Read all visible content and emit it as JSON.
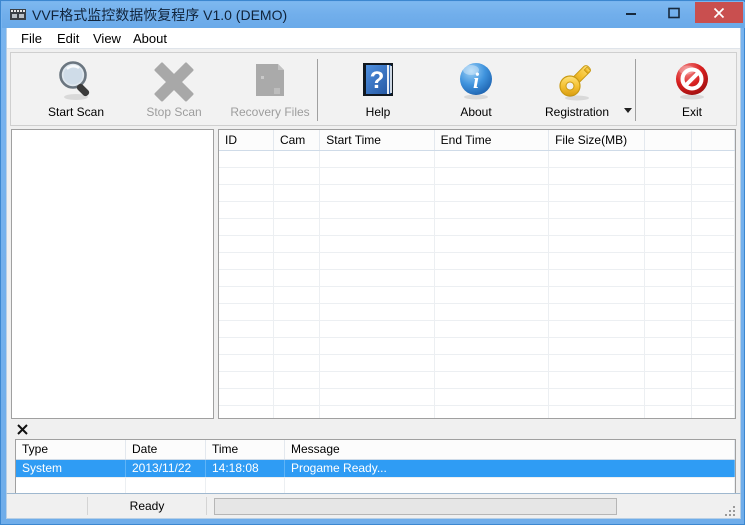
{
  "window": {
    "title": "VVF格式监控数据恢复程序 V1.0 (DEMO)",
    "app_icon": "camera-icon",
    "minimize_label": "Minimize",
    "maximize_label": "Maximize",
    "close_label": "Close",
    "accent_titlebar": "#72afeb",
    "close_button_color": "#c94f4f"
  },
  "menubar": {
    "items": [
      {
        "label": "File"
      },
      {
        "label": "Edit"
      },
      {
        "label": "View"
      },
      {
        "label": "About"
      }
    ]
  },
  "toolbar": {
    "buttons": [
      {
        "label": "Start Scan",
        "icon": "magnifier-icon",
        "disabled": false
      },
      {
        "label": "Stop Scan",
        "icon": "cross-x-icon",
        "disabled": true
      },
      {
        "label": "Recovery Files",
        "icon": "folder-icon",
        "disabled": true
      },
      {
        "label": "Help",
        "icon": "help-book-icon",
        "disabled": false
      },
      {
        "label": "About",
        "icon": "info-circle-icon",
        "disabled": false
      },
      {
        "label": "Registration",
        "icon": "key-icon",
        "disabled": false
      },
      {
        "label": "Exit",
        "icon": "no-entry-icon",
        "disabled": false
      }
    ],
    "dropdown_icon": "chevron-down-icon"
  },
  "tree_panel": {
    "items": []
  },
  "file_list": {
    "columns": [
      "ID",
      "Cam",
      "Start Time",
      "End Time",
      "File Size(MB)",
      "",
      ""
    ],
    "rows": []
  },
  "log_panel": {
    "close_icon": "close-icon",
    "columns": [
      "Type",
      "Date",
      "Time",
      "Message"
    ],
    "rows": [
      {
        "type": "System",
        "date": "2013/11/22",
        "time": "14:18:08",
        "message": "Progame Ready...",
        "selected": true
      }
    ],
    "selection_color": "#2f9cf4"
  },
  "statusbar": {
    "status": "Ready",
    "progress_percent": 0,
    "resize_grip": "resize-grip-icon"
  }
}
